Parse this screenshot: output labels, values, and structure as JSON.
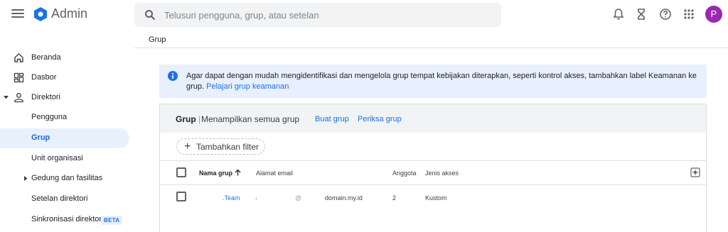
{
  "app": {
    "title": "Admin",
    "avatar_letter": "P",
    "avatar_color": "#9c27b0",
    "accent": "#1a73e8"
  },
  "search": {
    "placeholder": "Telusuri pengguna, grup, atau setelan",
    "value": ""
  },
  "topbar_icons": [
    "menu-icon",
    "bell-icon",
    "hourglass-icon",
    "help-icon",
    "apps-grid-icon"
  ],
  "breadcrumb": "Grup",
  "sidebar": {
    "items": [
      {
        "label": "Beranda",
        "icon": "home-icon"
      },
      {
        "label": "Dasbor",
        "icon": "dashboard-icon"
      },
      {
        "label": "Direktori",
        "icon": "person-icon",
        "expanded": true
      },
      {
        "label": "Pengguna"
      },
      {
        "label": "Grup",
        "active": true
      },
      {
        "label": "Unit organisasi"
      },
      {
        "label": "Gedung dan fasilitas",
        "collapsed": true
      },
      {
        "label": "Setelan direktori"
      },
      {
        "label": "Sinkronisasi direktori",
        "badge": "BETA"
      }
    ]
  },
  "banner": {
    "text": "Agar dapat dengan mudah mengidentifikasi dan mengelola grup tempat kebijakan diterapkan, seperti kontrol akses, tambahkan label Keamanan ke grup.",
    "link": "Pelajari grup keamanan"
  },
  "card": {
    "title": "Grup",
    "separator": "|",
    "subtitle": "Menampilkan semua grup",
    "links": [
      "Buat grup",
      "Periksa grup"
    ],
    "filter_label": "Tambahkan filter",
    "columns": [
      "Nama grup",
      "Alamat email",
      "Anggota",
      "Jenis akses"
    ],
    "sort_icon": "arrow-up-icon",
    "rows": [
      {
        "name": ".Team",
        "email_prefix": "↓",
        "email_at": "@",
        "email_domain": "domain.my.id",
        "members": "2",
        "access": "Kustom"
      }
    ]
  }
}
